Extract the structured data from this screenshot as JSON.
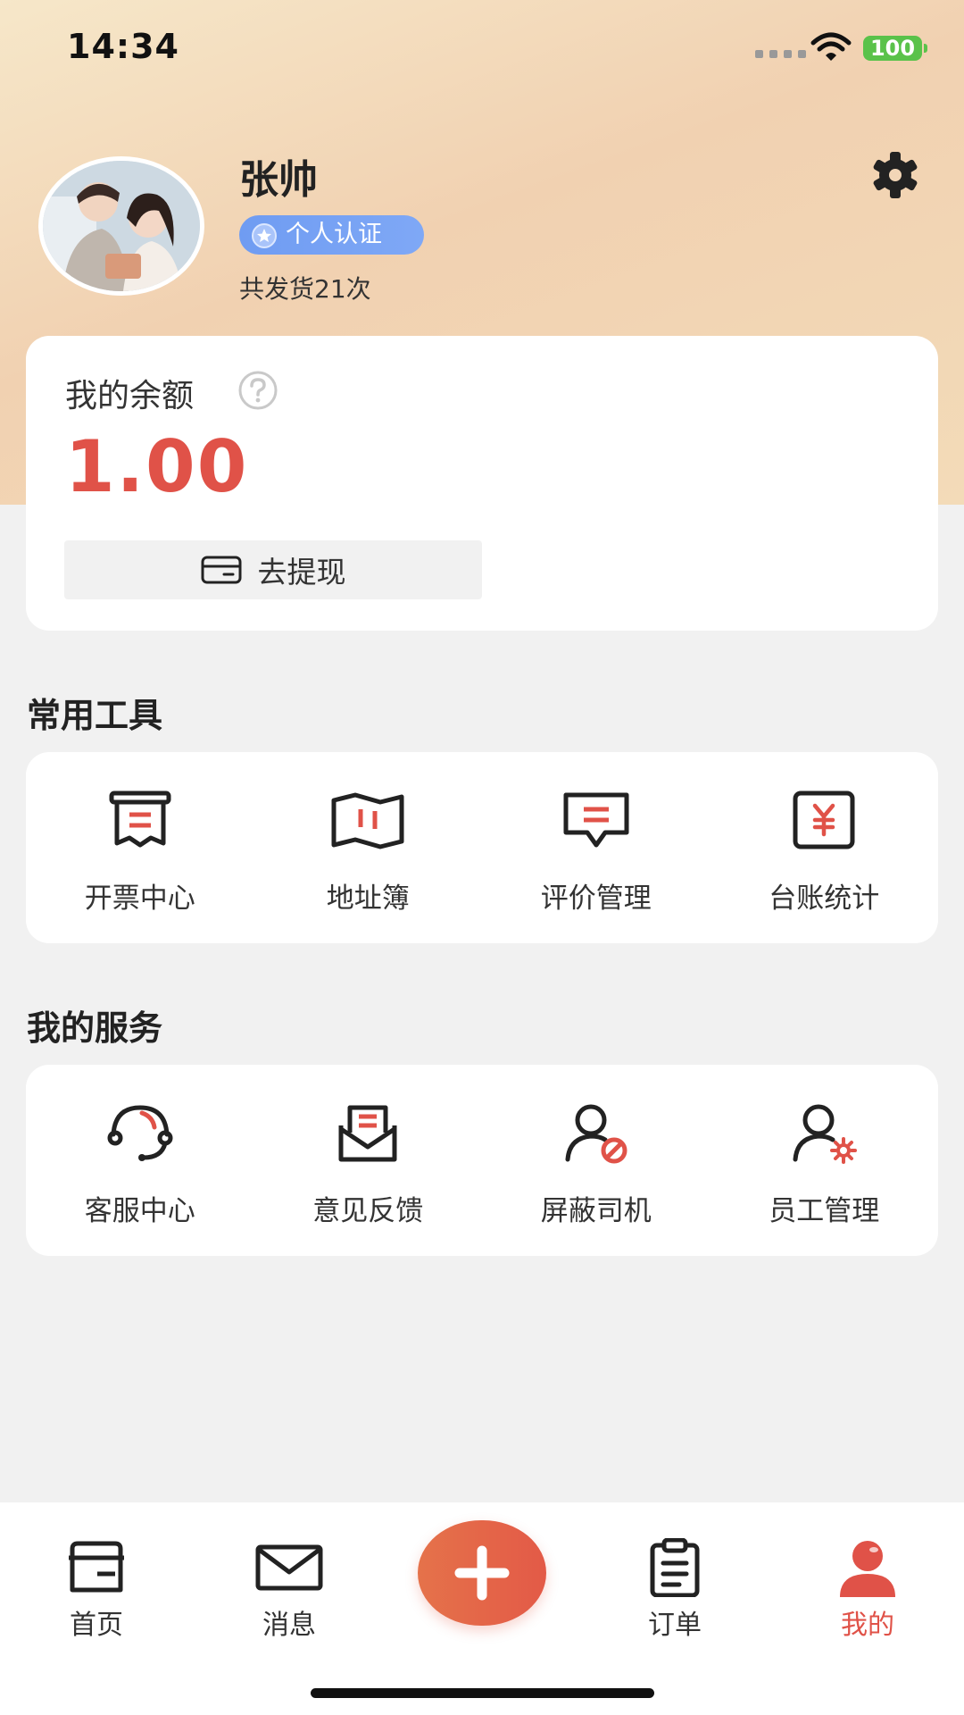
{
  "status_bar": {
    "time": "14:34",
    "battery": "100"
  },
  "profile": {
    "name": "张帅",
    "auth_badge": "个人认证",
    "ship_count": "共发货21次"
  },
  "balance": {
    "label": "我的余额",
    "amount": "1.00",
    "withdraw_label": "去提现"
  },
  "tools": {
    "title": "常用工具",
    "items": [
      {
        "label": "开票中心",
        "icon": "invoice-icon"
      },
      {
        "label": "地址簿",
        "icon": "map-icon"
      },
      {
        "label": "评价管理",
        "icon": "comment-icon"
      },
      {
        "label": "台账统计",
        "icon": "ledger-icon"
      }
    ]
  },
  "services": {
    "title": "我的服务",
    "items": [
      {
        "label": "客服中心",
        "icon": "headset-icon"
      },
      {
        "label": "意见反馈",
        "icon": "feedback-icon"
      },
      {
        "label": "屏蔽司机",
        "icon": "block-driver-icon"
      },
      {
        "label": "员工管理",
        "icon": "staff-manage-icon"
      }
    ]
  },
  "tabbar": {
    "items": [
      {
        "label": "首页",
        "icon": "home-icon"
      },
      {
        "label": "消息",
        "icon": "mail-icon"
      },
      {
        "label": "",
        "icon": "plus-icon"
      },
      {
        "label": "订单",
        "icon": "clipboard-icon"
      },
      {
        "label": "我的",
        "icon": "person-icon"
      }
    ]
  },
  "colors": {
    "accent": "#e05248",
    "badge": "#7aa3f4",
    "card": "#ffffff",
    "page": "#f1f1f1"
  }
}
